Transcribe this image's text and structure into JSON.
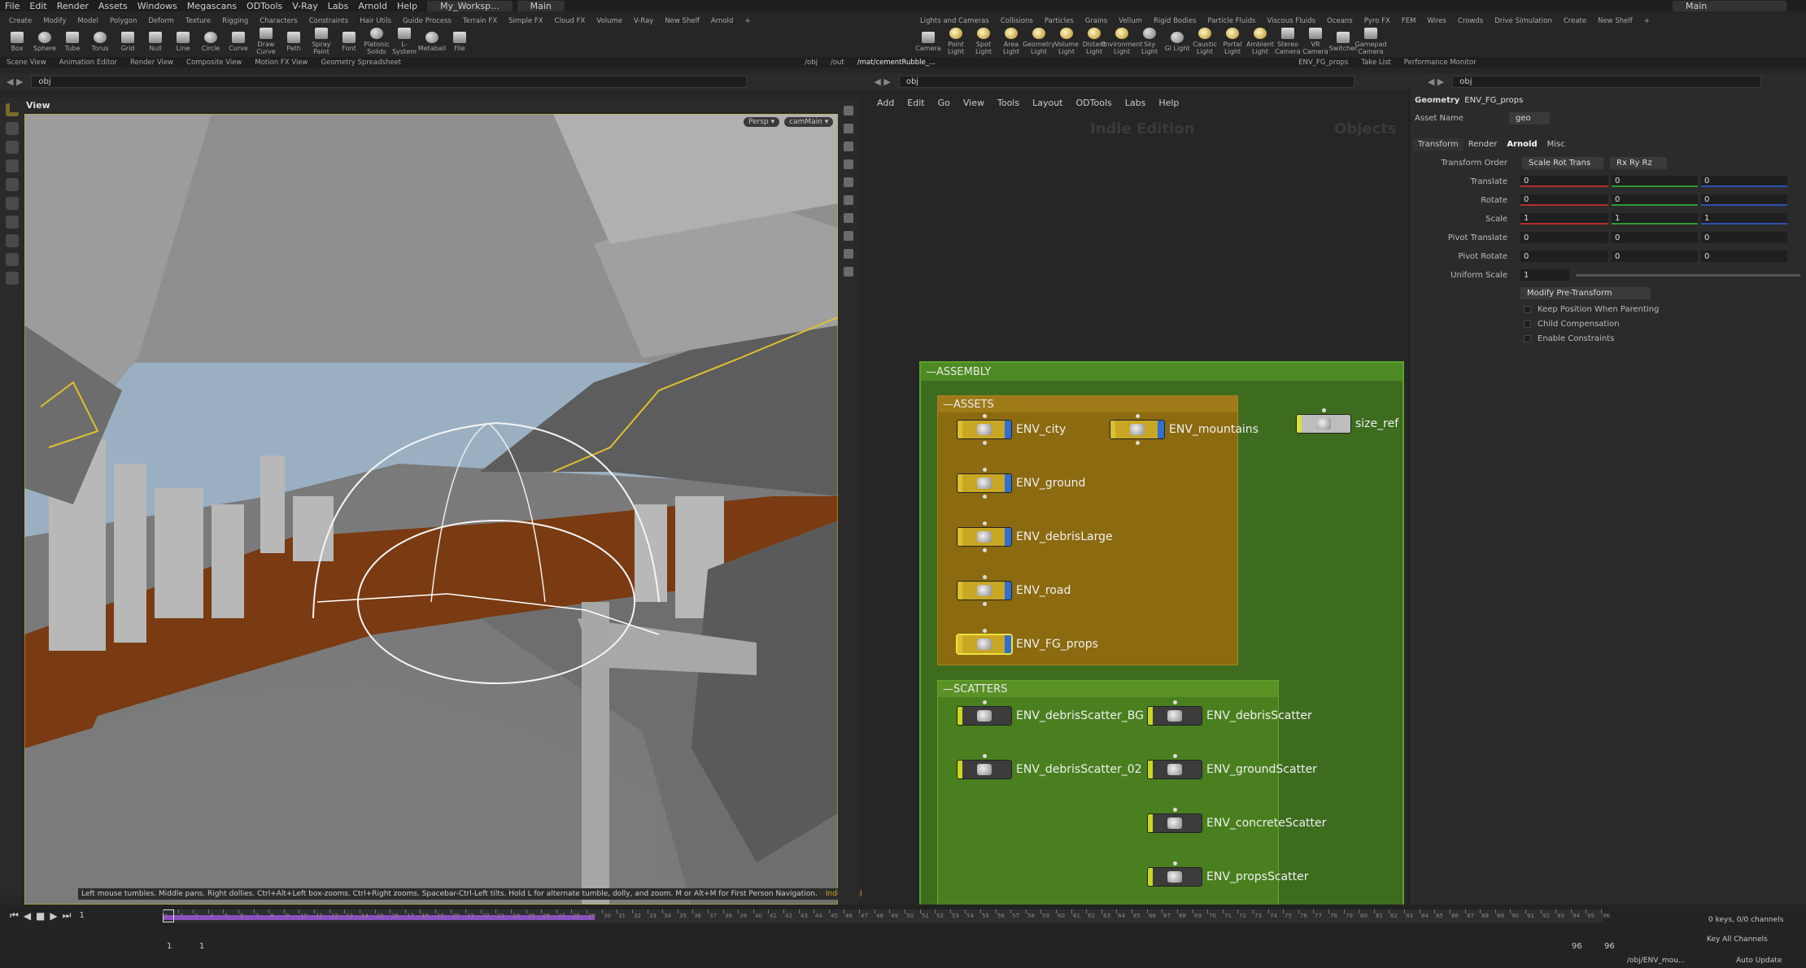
{
  "menubar": {
    "items": [
      "File",
      "Edit",
      "Render",
      "Assets",
      "Windows",
      "Megascans",
      "ODTools",
      "V-Ray",
      "Labs",
      "Arnold",
      "Help"
    ],
    "workspace": "My_Worksp...",
    "desktop": "Main",
    "desktop_right": "Main"
  },
  "shelf_left": {
    "tabs": [
      "Create",
      "Modify",
      "Model",
      "Polygon",
      "Deform",
      "Texture",
      "Rigging",
      "Characters",
      "Constraints",
      "Hair Utils",
      "Guide Process",
      "Terrain FX",
      "Simple FX",
      "Cloud FX",
      "Volume",
      "V-Ray",
      "New Shelf",
      "Arnold"
    ],
    "tools": [
      "Box",
      "Sphere",
      "Tube",
      "Torus",
      "Grid",
      "Null",
      "Line",
      "Circle",
      "Curve",
      "Draw Curve",
      "Path",
      "Spray Paint",
      "Font",
      "Platonic Solids",
      "L-System",
      "Metaball",
      "File"
    ]
  },
  "shelf_right": {
    "tabs": [
      "Lights and Cameras",
      "Collisions",
      "Particles",
      "Grains",
      "Vellum",
      "Rigid Bodies",
      "Particle Fluids",
      "Viscous Fluids",
      "Oceans",
      "Pyro FX",
      "FEM",
      "Wires",
      "Crowds",
      "Drive Simulation",
      "Create",
      "New Shelf"
    ],
    "tools": [
      "Camera",
      "Point Light",
      "Spot Light",
      "Area Light",
      "Geometry Light",
      "Volume Light",
      "Distant Light",
      "Environment Light",
      "Sky Light",
      "GI Light",
      "Caustic Light",
      "Portal Light",
      "Ambient Light",
      "Stereo Camera",
      "VR Camera",
      "Switcher",
      "Gamepad Camera"
    ]
  },
  "pane_tabs_left": [
    "Scene View",
    "Animation Editor",
    "Render View",
    "Composite View",
    "Motion FX View",
    "Geometry Spreadsheet"
  ],
  "pane_tabs_mid": [
    "/obj",
    "/out",
    "/mat/cementRubble_..."
  ],
  "pane_tabs_right": [
    "ENV_FG_props",
    "Take List",
    "Performance Monitor"
  ],
  "paths": {
    "left": "obj",
    "mid": "obj",
    "right": "obj"
  },
  "viewport": {
    "title": "View",
    "persp": "Persp ▾",
    "cam": "camMain ▾",
    "status": "Left mouse tumbles. Middle pans. Right dollies. Ctrl+Alt+Left box-zooms. Ctrl+Right zooms. Spacebar-Ctrl-Left tilts. Hold L for alternate tumble, dolly, and zoom.    M or Alt+M for First Person Navigation.",
    "edition": "Indie Edition"
  },
  "network": {
    "menu": [
      "Add",
      "Edit",
      "Go",
      "View",
      "Tools",
      "Layout",
      "ODTools",
      "Labs",
      "Help"
    ],
    "watermark_left": "Indie Edition",
    "watermark_right": "Objects",
    "assembly_label": "ASSEMBLY",
    "assets_label": "ASSETS",
    "scatters_label": "SCATTERS",
    "asset_nodes": [
      "ENV_city",
      "ENV_ground",
      "ENV_debrisLarge",
      "ENV_road",
      "ENV_FG_props"
    ],
    "mountains_node": "ENV_mountains",
    "size_ref_node": "size_ref",
    "scatter_nodes_left": [
      "ENV_debrisScatter_BG",
      "ENV_debrisScatter_02"
    ],
    "scatter_nodes_right": [
      "ENV_debrisScatter",
      "ENV_groundScatter",
      "ENV_concreteScatter",
      "ENV_propsScatter"
    ]
  },
  "params": {
    "type": "Geometry",
    "node": "ENV_FG_props",
    "asset_name_label": "Asset Name",
    "asset_name_value": "geo",
    "tabs": [
      "Transform",
      "Render",
      "Arnold",
      "Misc"
    ],
    "transform_order_label": "Transform Order",
    "transform_order": "Scale Rot Trans",
    "rot_order": "Rx Ry Rz",
    "rows": [
      {
        "label": "Translate",
        "v": [
          "0",
          "0",
          "0"
        ]
      },
      {
        "label": "Rotate",
        "v": [
          "0",
          "0",
          "0"
        ]
      },
      {
        "label": "Scale",
        "v": [
          "1",
          "1",
          "1"
        ]
      },
      {
        "label": "Pivot Translate",
        "v": [
          "0",
          "0",
          "0"
        ]
      },
      {
        "label": "Pivot Rotate",
        "v": [
          "0",
          "0",
          "0"
        ]
      }
    ],
    "uniform_scale_label": "Uniform Scale",
    "uniform_scale": "1",
    "modify_pretransform": "Modify Pre-Transform",
    "checks": [
      "Keep Position When Parenting",
      "Child Compensation",
      "Enable Constraints"
    ]
  },
  "timeline": {
    "frame": "1",
    "start": "1",
    "start2": "1",
    "end": "96",
    "end2": "96",
    "played_fraction": 0.3,
    "keys": "0 keys, 0/0 channels",
    "key_all": "Key All Channels",
    "path": "/obj/ENV_mou...",
    "auto_update": "Auto Update"
  }
}
